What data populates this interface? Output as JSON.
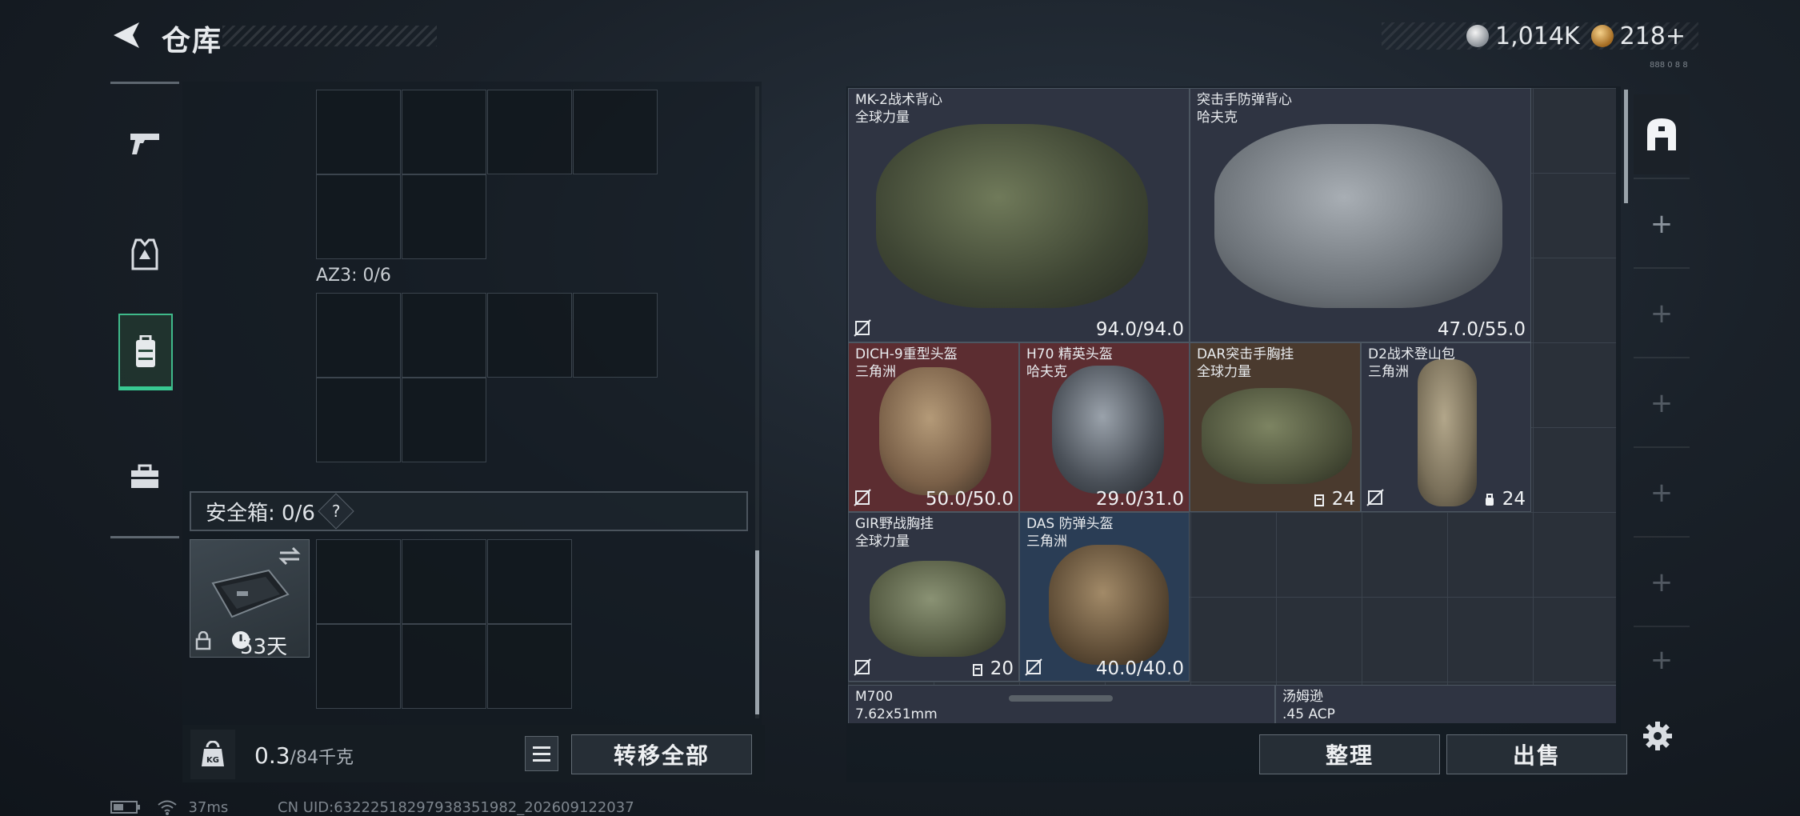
{
  "header": {
    "title": "仓库",
    "currency": [
      {
        "icon": "silver-coin-icon",
        "value": "1,014K"
      },
      {
        "icon": "gold-coin-icon",
        "value": "218",
        "suffix": "+"
      }
    ],
    "tiny_id": "888 0 8 8"
  },
  "left_tabs": [
    {
      "name": "weapons-tab",
      "icon": "pistol-icon",
      "active": false
    },
    {
      "name": "armor-tab",
      "icon": "vest-icon",
      "active": false
    },
    {
      "name": "backpack-tab",
      "icon": "backpack-icon",
      "active": true
    },
    {
      "name": "case-tab",
      "icon": "briefcase-icon",
      "active": false
    }
  ],
  "backpack": {
    "section_label": "AZ3: 0/6",
    "safebox_label": "安全箱: 0/6",
    "help": "?",
    "safebox_days": "53天",
    "weight_value": "0.3",
    "weight_max": "/84千克",
    "kg_label": "KG",
    "transfer_all": "转移全部"
  },
  "warehouse": {
    "items": [
      {
        "name": "MK-2战术背心",
        "sub": "全球力量",
        "value": "94.0/94.0"
      },
      {
        "name": "突击手防弹背心",
        "sub": "哈夫克",
        "value": "47.0/55.0"
      },
      {
        "name": "DICH-9重型头盔",
        "sub": "三角洲",
        "value": "50.0/50.0"
      },
      {
        "name": "H70 精英头盔",
        "sub": "哈夫克",
        "value": "29.0/31.0"
      },
      {
        "name": "DAR突击手胸挂",
        "sub": "全球力量",
        "value": "24"
      },
      {
        "name": "D2战术登山包",
        "sub": "三角洲",
        "value": "24"
      },
      {
        "name": "GIR野战胸挂",
        "sub": "全球力量",
        "value": "20"
      },
      {
        "name": "DAS 防弹头盔",
        "sub": "三角洲",
        "value": "40.0/40.0"
      },
      {
        "name": "M700",
        "sub": "7.62x51mm",
        "value": ""
      },
      {
        "name": "汤姆逊",
        "sub": ".45 ACP",
        "value": ""
      }
    ],
    "sort_button": "整理",
    "sell_button": "出售"
  },
  "side_tabs": [
    "+",
    "+",
    "+",
    "+",
    "+",
    "+"
  ],
  "status": {
    "ping": "37ms",
    "uid": "CN UID:6322251829793835198​2_202609122037"
  }
}
